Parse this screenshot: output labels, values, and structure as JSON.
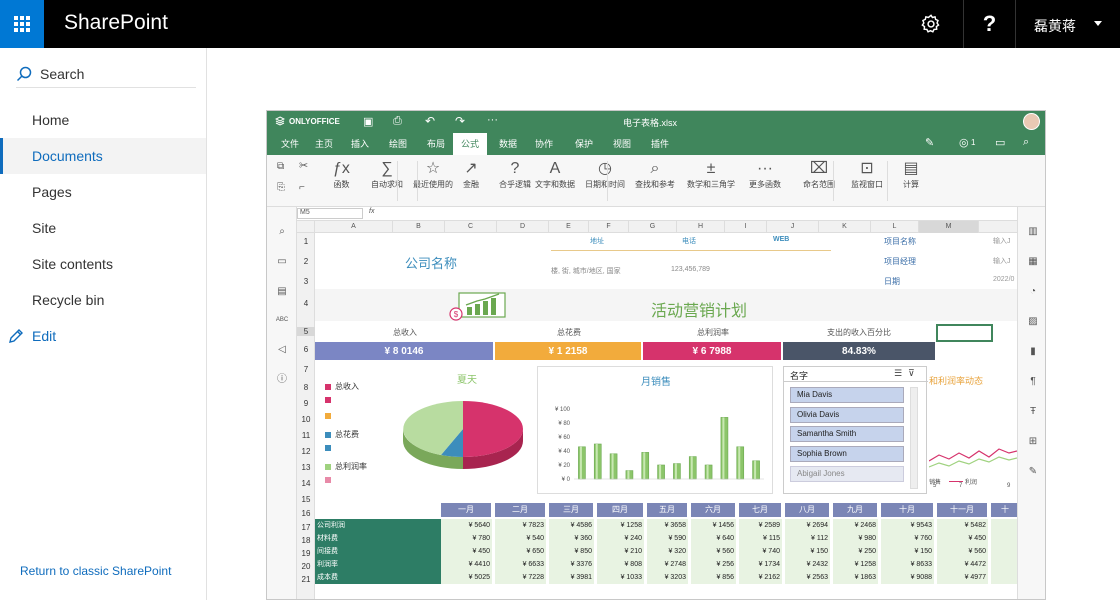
{
  "header": {
    "brand": "SharePoint",
    "help": "?",
    "user": "磊黄蒋"
  },
  "nav": {
    "search": "Search",
    "items": [
      "Home",
      "Documents",
      "Pages",
      "Site",
      "Site contents",
      "Recycle bin"
    ],
    "selected_index": 1,
    "edit": "Edit",
    "classic": "Return to classic SharePoint"
  },
  "editor": {
    "logo": "ONLYOFFICE",
    "filename": "电子表格.xlsx",
    "menu": [
      "文件",
      "主页",
      "插入",
      "绘图",
      "布局",
      "公式",
      "数据",
      "协作",
      "保护",
      "视图",
      "插件"
    ],
    "menu_selected": 5,
    "users_count": "1",
    "toolbar": [
      "函数",
      "自动求和",
      "最近使用的",
      "金融",
      "合乎逻辑",
      "文字和数据",
      "日期和时间",
      "查找和参考",
      "数学和三角学",
      "更多函数",
      "命名范围",
      "监视窗口",
      "计算"
    ],
    "namebox": "M5",
    "fx": "fx",
    "columns": [
      "A",
      "B",
      "C",
      "D",
      "E",
      "F",
      "G",
      "H",
      "I",
      "J",
      "K",
      "L",
      "M"
    ],
    "rows": [
      "1",
      "2",
      "3",
      "4",
      "5",
      "6",
      "7",
      "8",
      "9",
      "10",
      "11",
      "12",
      "13",
      "14",
      "15",
      "16",
      "17",
      "18",
      "19",
      "20",
      "21"
    ]
  },
  "sheet": {
    "company": "公司名称",
    "address_hdr": "地址",
    "phone_hdr": "电话",
    "web_hdr": "WEB",
    "address": "楼, 街, 城市/地区, 国家",
    "phone": "123,456,789",
    "proj_name": "项目名称",
    "proj_mgr": "项目经理",
    "date": "日期",
    "input1": "输入J",
    "input2": "输入J",
    "date_val": "2022/0",
    "plan_title": "活动营销计划",
    "kpi_labels": [
      "总收入",
      "总花费",
      "总利润率",
      "支出的收入百分比"
    ],
    "kpi_values": [
      "¥ 8 0146",
      "¥ 1 2158",
      "¥ 6 7988",
      "84.83%"
    ],
    "kpi_colors": [
      "#7b86c4",
      "#f2ab3c",
      "#d6336c",
      "#4a5568"
    ],
    "pie_title": "夏天",
    "pie_legend": [
      "总收入",
      "",
      "",
      "总花费",
      "",
      "总利润率",
      ""
    ],
    "pie_legend_colors": [
      "#d6336c",
      "#d6336c",
      "#f2ab3c",
      "#3c8dbc",
      "#3c8dbc",
      "#9fd27f",
      "#e88aa8"
    ],
    "bar_title": "月销售",
    "slicer_title": "名字",
    "slicer_items": [
      "Mia Davis",
      "Olivia Davis",
      "Samantha Smith",
      "Sophia Brown",
      "Abigail Jones"
    ],
    "trend_title": "和利润率动态",
    "trend_legend": [
      "销售",
      "利润"
    ],
    "trend_ticks": [
      "5",
      "7",
      "9"
    ],
    "months": [
      "一月",
      "二月",
      "三月",
      "四月",
      "五月",
      "六月",
      "七月",
      "八月",
      "九月",
      "十月",
      "十一月",
      "十"
    ],
    "table_rows": [
      {
        "name": "公司利润",
        "vals": [
          "¥ 5640",
          "¥ 7823",
          "¥ 4586",
          "¥ 1258",
          "¥ 3658",
          "¥ 1456",
          "¥ 2589",
          "¥ 2694",
          "¥ 2468",
          "¥ 9543",
          "¥ 5482"
        ]
      },
      {
        "name": "材料费",
        "vals": [
          "¥ 780",
          "¥ 540",
          "¥ 360",
          "¥ 240",
          "¥ 590",
          "¥ 640",
          "¥ 115",
          "¥ 112",
          "¥ 980",
          "¥ 760",
          "¥ 450"
        ]
      },
      {
        "name": "间接费",
        "vals": [
          "¥ 450",
          "¥ 650",
          "¥ 850",
          "¥ 210",
          "¥ 320",
          "¥ 560",
          "¥ 740",
          "¥ 150",
          "¥ 250",
          "¥ 150",
          "¥ 560"
        ]
      },
      {
        "name": "利润率",
        "vals": [
          "¥ 4410",
          "¥ 6633",
          "¥ 3376",
          "¥ 808",
          "¥ 2748",
          "¥ 256",
          "¥ 1734",
          "¥ 2432",
          "¥ 1258",
          "¥ 8633",
          "¥ 4472"
        ]
      },
      {
        "name": "成本费",
        "vals": [
          "¥ 5025",
          "¥ 7228",
          "¥ 3981",
          "¥ 1033",
          "¥ 3203",
          "¥ 856",
          "¥ 2162",
          "¥ 2563",
          "¥ 1863",
          "¥ 9088",
          "¥ 4977"
        ]
      }
    ]
  },
  "chart_data": {
    "type": "bar",
    "title": "月销售",
    "y_ticks": [
      "¥ 100",
      "¥ 80",
      "¥ 60",
      "¥ 40",
      "¥ 20",
      "¥ 0"
    ],
    "ylim": [
      0,
      100
    ],
    "values": [
      46,
      50,
      36,
      12,
      38,
      20,
      22,
      32,
      20,
      88,
      46,
      26
    ],
    "color": "#8cc56a"
  }
}
